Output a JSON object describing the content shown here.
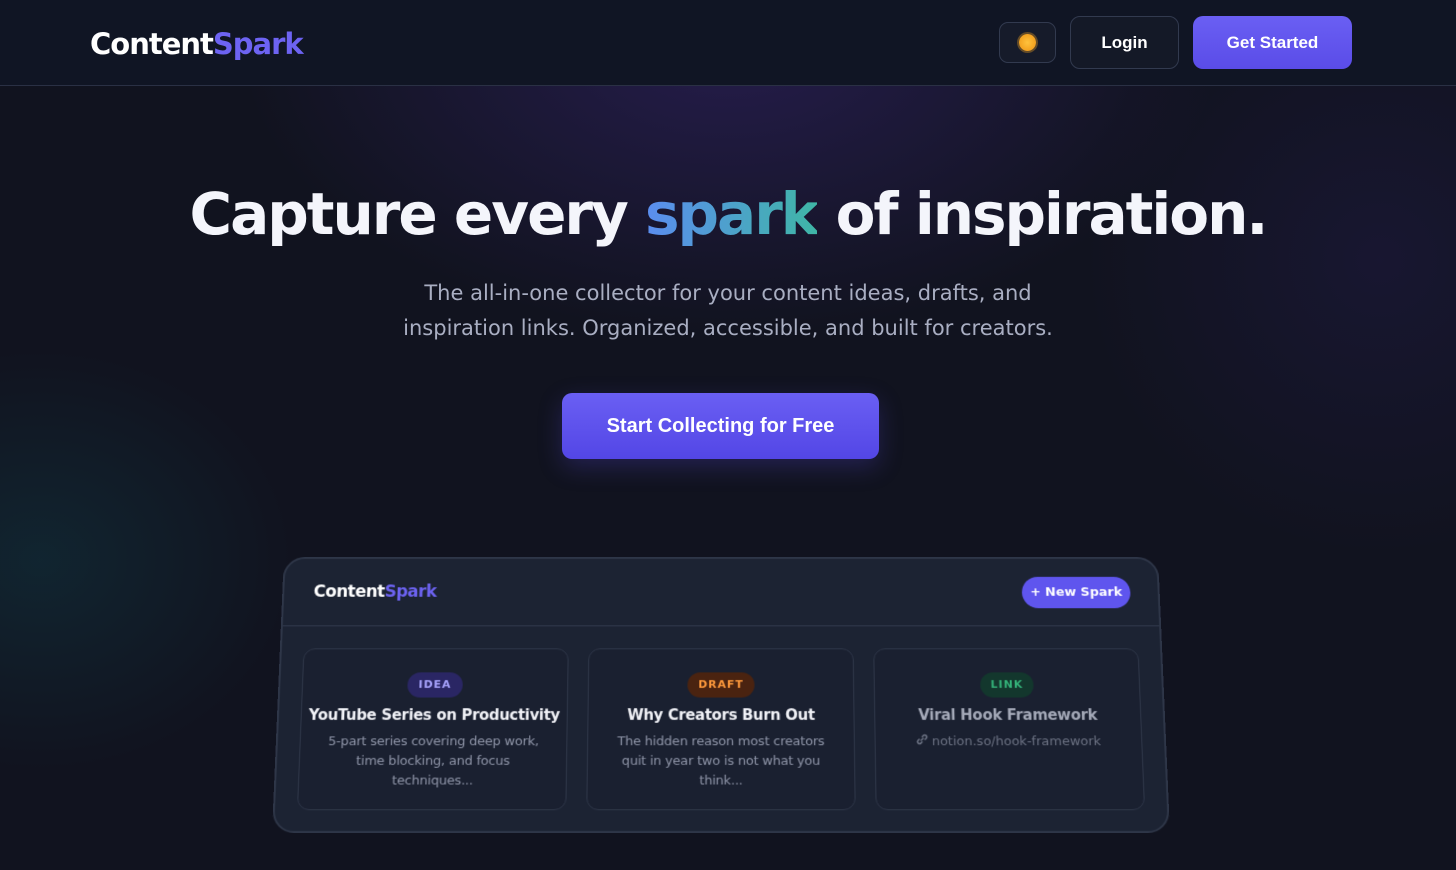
{
  "brand": {
    "name_part1": "Content",
    "name_part2": "Spark",
    "accent_color": "#6d63f2"
  },
  "nav": {
    "theme_icon": "sun-icon",
    "login_label": "Login",
    "get_started_label": "Get Started"
  },
  "hero": {
    "title_before": "Capture every ",
    "title_highlight": "spark",
    "title_after": " of inspiration.",
    "subtitle": "The all-in-one collector for your content ideas, drafts, and inspiration links. Organized, accessible, and built for creators.",
    "cta_label": "Start Collecting for Free"
  },
  "preview": {
    "logo_part1": "Content",
    "logo_part2": "Spark",
    "new_button_label": "+ New Spark",
    "cards": [
      {
        "tag": "IDEA",
        "title": "YouTube Series on Productivity",
        "description": "5-part series covering deep work, time blocking, and focus techniques..."
      },
      {
        "tag": "DRAFT",
        "title": "Why Creators Burn Out",
        "description": "The hidden reason most creators quit in year two is not what you think..."
      },
      {
        "tag": "LINK",
        "title": "Viral Hook Framework",
        "link_icon": "link-icon",
        "link": "notion.so/hook-framework"
      }
    ]
  },
  "colors": {
    "primary": "#5f55ee",
    "idea_tag": "#a9a5ff",
    "draft_tag": "#ff9a3c",
    "link_tag": "#34b37a"
  }
}
